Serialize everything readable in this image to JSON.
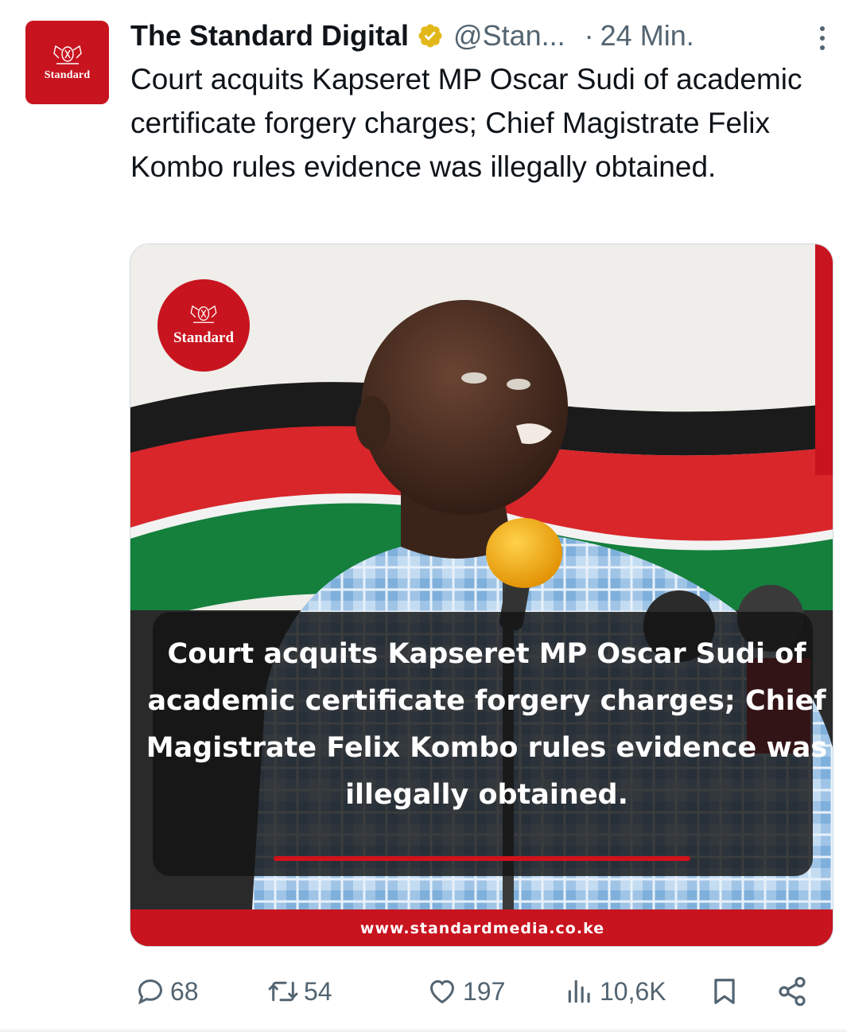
{
  "colors": {
    "brand_red": "#c8141f",
    "verified_gold": "#e2b719",
    "muted_text": "#536471",
    "text": "#0f1419"
  },
  "author": {
    "avatar_brand": "Standard",
    "display_name": "The Standard Digital",
    "verified_icon": "verified-badge-gold",
    "handle": "@Stan...",
    "separator": "·",
    "time": "24 Min."
  },
  "tweet": {
    "text": "Court acquits Kapseret MP Oscar Sudi of academic certificate forgery charges; Chief Magistrate Felix Kombo rules evidence was illegally obtained."
  },
  "media": {
    "logo_brand": "Standard",
    "caption": "Court acquits Kapseret MP Oscar Sudi of academic certificate forgery charges; Chief Magistrate Felix Kombo rules evidence was illegally obtained.",
    "footer_url": "www.standardmedia.co.ke"
  },
  "actions": {
    "replies": "68",
    "reposts": "54",
    "likes": "197",
    "views": "10,6K",
    "icons": [
      "reply-icon",
      "repost-icon",
      "like-icon",
      "views-icon",
      "bookmark-icon",
      "share-icon"
    ]
  }
}
